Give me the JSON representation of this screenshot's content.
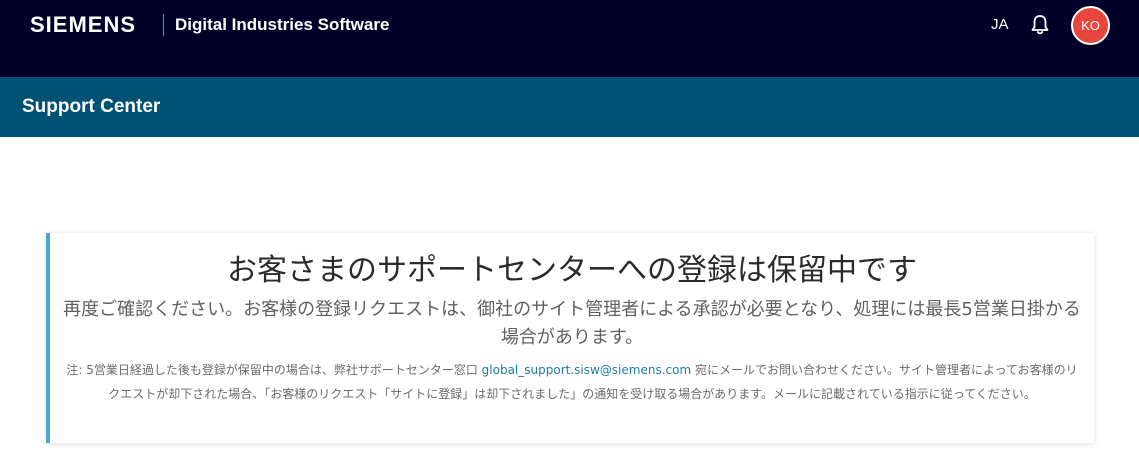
{
  "header": {
    "brand": "SIEMENS",
    "product": "Digital Industries Software",
    "language": "JA",
    "avatar_initials": "KO",
    "icons": {
      "notifications": "bell-icon"
    },
    "colors": {
      "bar": "#000028",
      "avatar": "#e8463d"
    }
  },
  "subheader": {
    "title": "Support Center",
    "color": "#005173"
  },
  "notice": {
    "accent_color": "#4da9c9",
    "title": "お客さまのサポートセンターへの登録は保留中です",
    "subtitle": "再度ご確認ください。お客様の登録リクエストは、御社のサイト管理者による承認が必要となり、処理には最長5営業日掛かる場合があります。",
    "note_before": "注: 5営業日経過した後も登録が保留中の場合は、弊社サポートセンター窓口 ",
    "email": "global_support.sisw@siemens.com",
    "note_after": " 宛にメールでお問い合わせください。サイト管理者によってお客様のリクエストが却下された場合、「お客様のリクエスト「サイトに登録」は却下されました」の通知を受け取る場合があります。メールに記載されている指示に従ってください。"
  }
}
